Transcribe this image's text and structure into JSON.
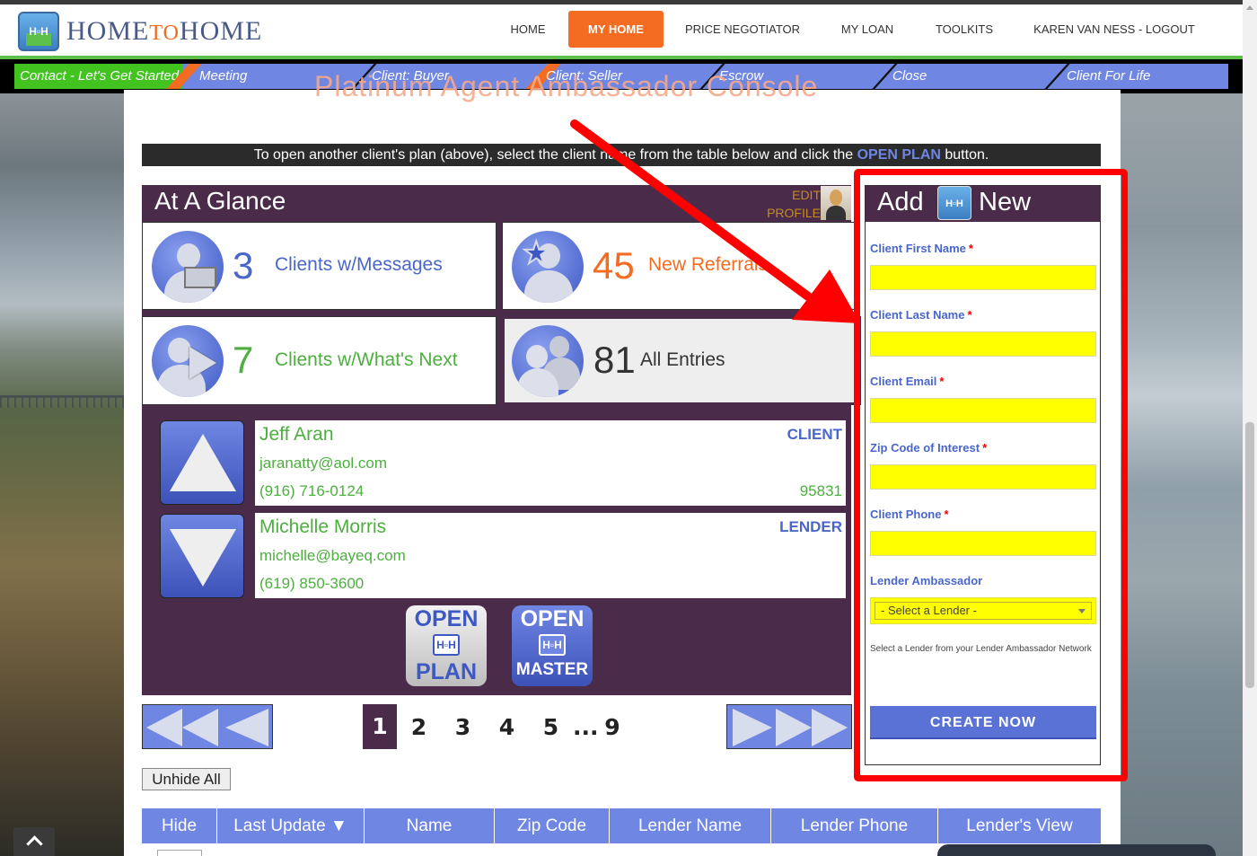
{
  "header": {
    "logo_text_home": "HOME",
    "logo_text_to": "TO",
    "logo_text_home2": "HOME",
    "logo_badge": "H▫H",
    "nav": [
      "HOME",
      "MY HOME",
      "PRICE NEGOTIATOR",
      "MY LOAN",
      "TOOLKITS",
      "KAREN VAN NESS - LOGOUT"
    ],
    "active_nav": "MY HOME"
  },
  "steps": [
    "Contact - Let's Get Started",
    "Meeting",
    "Client: Buyer",
    "Client: Seller",
    "Escrow",
    "Close",
    "Client For Life"
  ],
  "page": {
    "ghost_title": "Platinum Agent Ambassador Console",
    "info_pre": "To open another client's plan (above), select the client name from the table below and click the",
    "info_link": "OPEN PLAN",
    "info_post": "button."
  },
  "glance": {
    "title": "At A Glance",
    "edit_profile_1": "EDIT",
    "edit_profile_2": "PROFILE",
    "cards": [
      {
        "count": "3",
        "label": "Clients w/Messages",
        "icon": "person-envelope-icon",
        "color": "#4a66c9"
      },
      {
        "count": "45",
        "label": "New Referrals",
        "icon": "person-star-icon",
        "color": "#f36c21"
      },
      {
        "count": "7",
        "label": "Clients w/What's Next",
        "icon": "person-play-icon",
        "color": "#4caf3e"
      },
      {
        "count": "81",
        "label": "All Entries",
        "icon": "group-icon",
        "color": "#333333"
      }
    ]
  },
  "entries": [
    {
      "name": "Jeff Aran",
      "email": "jaranatty@aol.com",
      "phone": "(916) 716-0124",
      "role": "CLIENT",
      "zip": "95831"
    },
    {
      "name": "Michelle Morris",
      "email": "michelle@bayeq.com",
      "phone": "(619) 850-3600",
      "role": "LENDER",
      "zip": ""
    }
  ],
  "buttons": {
    "open_plan_1": "OPEN",
    "open_plan_2": "PLAN",
    "open_master_1": "OPEN",
    "open_master_2": "MASTER",
    "mini_badge": "H▫H"
  },
  "pagination": {
    "current": "1",
    "pages": [
      "2",
      "3",
      "4",
      "5"
    ],
    "ellipsis": "...",
    "last": "9"
  },
  "table": {
    "unhide": "Unhide All",
    "columns": [
      "Hide",
      "Last Update ▼",
      "Name",
      "Zip Code",
      "Lender Name",
      "Lender Phone",
      "Lender's View"
    ]
  },
  "add_new": {
    "title_1": "Add",
    "title_2": "New",
    "badge": "H▫H",
    "fields": [
      {
        "label": "Client First Name",
        "required": "*",
        "value": ""
      },
      {
        "label": "Client Last Name",
        "required": "*",
        "value": ""
      },
      {
        "label": "Client Email",
        "required": "*",
        "value": ""
      },
      {
        "label": "Zip Code of Interest",
        "required": "*",
        "value": ""
      },
      {
        "label": "Client Phone",
        "required": "*",
        "value": ""
      }
    ],
    "lender_label": "Lender Ambassador",
    "lender_selected": "- Select a Lender -",
    "lender_help": "Select a Lender from your Lender Ambassador Network",
    "create": "CREATE NOW"
  },
  "colors": {
    "accent_orange": "#f36c21",
    "brand_purple": "#4a2c4a",
    "brand_blue": "#6f86e3",
    "green": "#4caf3e",
    "highlight_red": "#ff0000",
    "input_yellow": "#ffff00"
  }
}
